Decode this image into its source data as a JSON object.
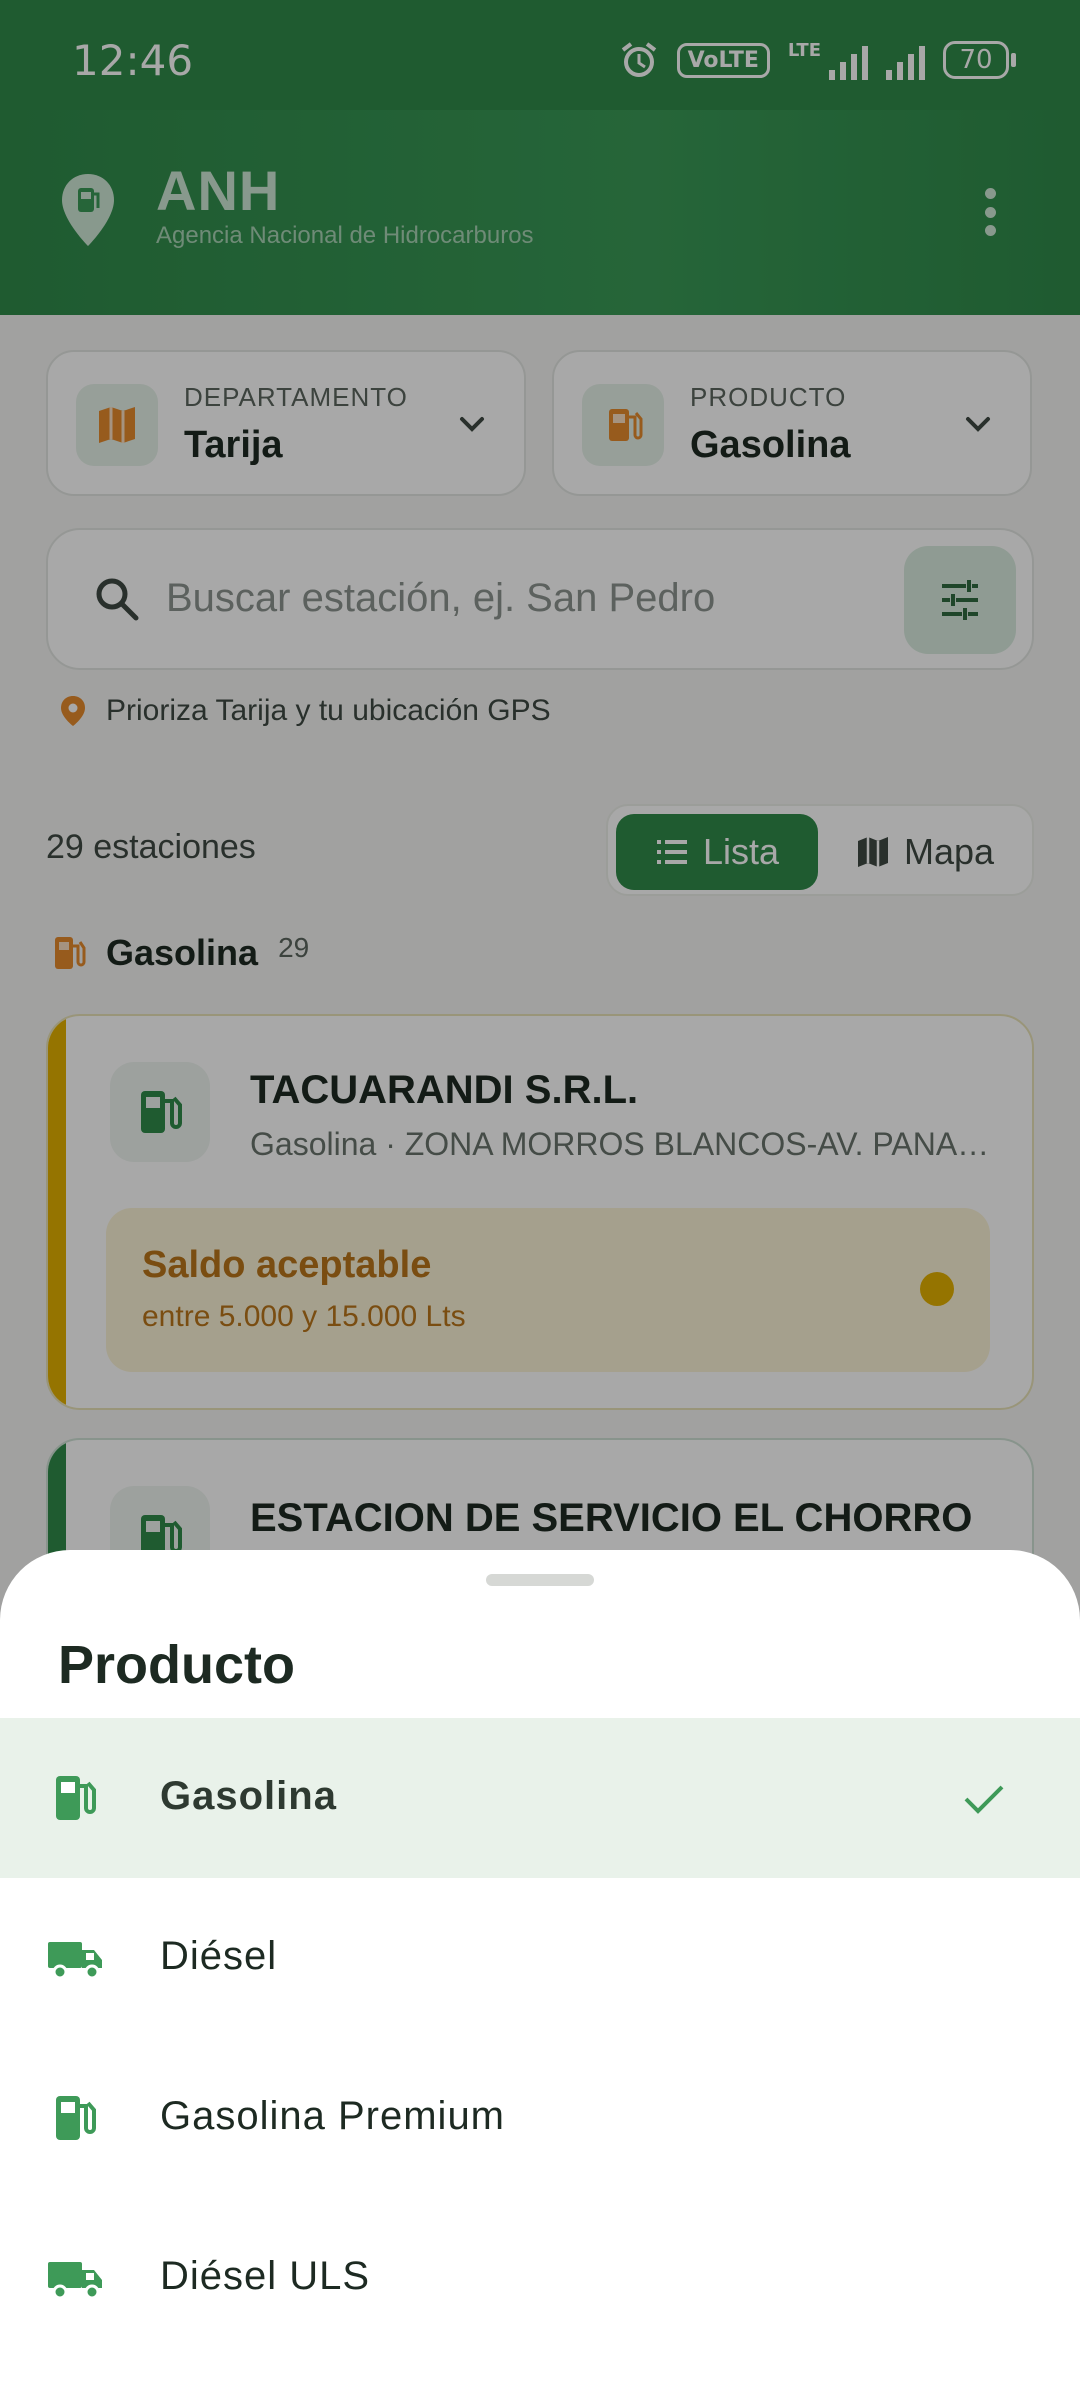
{
  "status_bar": {
    "time": "12:46",
    "volte": "VoLTE",
    "lte": "LTE",
    "battery": "70"
  },
  "app_bar": {
    "title": "ANH",
    "subtitle": "Agencia Nacional de Hidrocarburos"
  },
  "filters": {
    "department_label": "DEPARTAMENTO",
    "department_value": "Tarija",
    "product_label": "PRODUCTO",
    "product_value": "Gasolina"
  },
  "search": {
    "placeholder": "Buscar estación, ej. San Pedro"
  },
  "hint": "Prioriza Tarija y tu ubicación GPS",
  "results": {
    "count_text": "29 estaciones",
    "view_list": "Lista",
    "view_map": "Mapa"
  },
  "section": {
    "name": "Gasolina",
    "count": "29"
  },
  "stations": [
    {
      "name": "TACUARANDI S.R.L.",
      "address": "Gasolina · ZONA MORROS BLANCOS-AV. PANAMERICANA",
      "status_title": "Saldo aceptable",
      "status_detail": "entre 5.000 y 15.000 Lts",
      "accent": "#e3b000"
    },
    {
      "name": "ESTACION DE SERVICIO EL CHORRO",
      "accent": "#2f8a4a"
    }
  ],
  "product_sheet": {
    "title": "Producto",
    "options": [
      {
        "label": "Gasolina",
        "icon": "fuel-pump-icon",
        "selected": true
      },
      {
        "label": "Diésel",
        "icon": "truck-icon",
        "selected": false
      },
      {
        "label": "Gasolina Premium",
        "icon": "fuel-pump-icon",
        "selected": false
      },
      {
        "label": "Diésel ULS",
        "icon": "truck-icon",
        "selected": false
      }
    ]
  },
  "colors": {
    "primary": "#2f8a4a",
    "warning": "#e3b000",
    "warning_text": "#b9751b",
    "selected_bg": "#e9f2ea"
  }
}
